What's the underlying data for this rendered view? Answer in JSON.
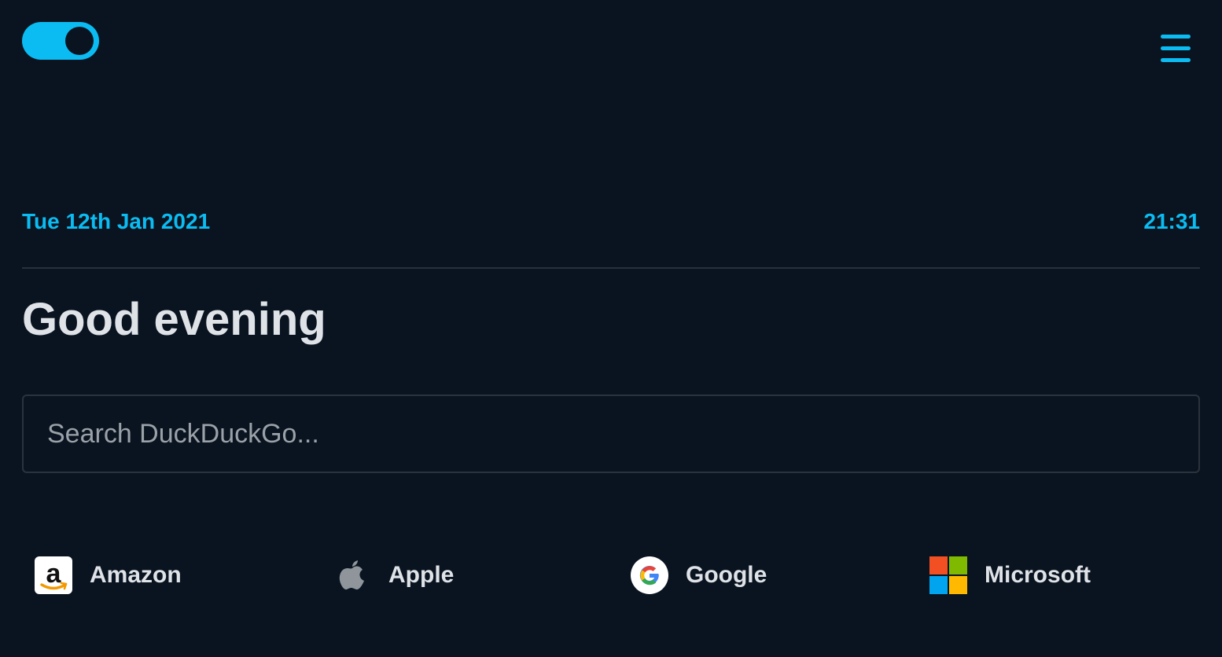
{
  "header": {
    "theme_toggle_icon": "moon-icon",
    "menu_icon": "hamburger-menu-icon",
    "accent_color": "#0bbcf2",
    "background_color": "#0a1420"
  },
  "date_bar": {
    "date": "Tue 12th Jan 2021",
    "time": "21:31"
  },
  "greeting": "Good evening",
  "search": {
    "placeholder": "Search DuckDuckGo...",
    "value": ""
  },
  "bookmarks": [
    {
      "label": "Amazon",
      "icon": "amazon-logo-icon"
    },
    {
      "label": "Apple",
      "icon": "apple-logo-icon"
    },
    {
      "label": "Google",
      "icon": "google-logo-icon"
    },
    {
      "label": "Microsoft",
      "icon": "microsoft-logo-icon"
    }
  ]
}
